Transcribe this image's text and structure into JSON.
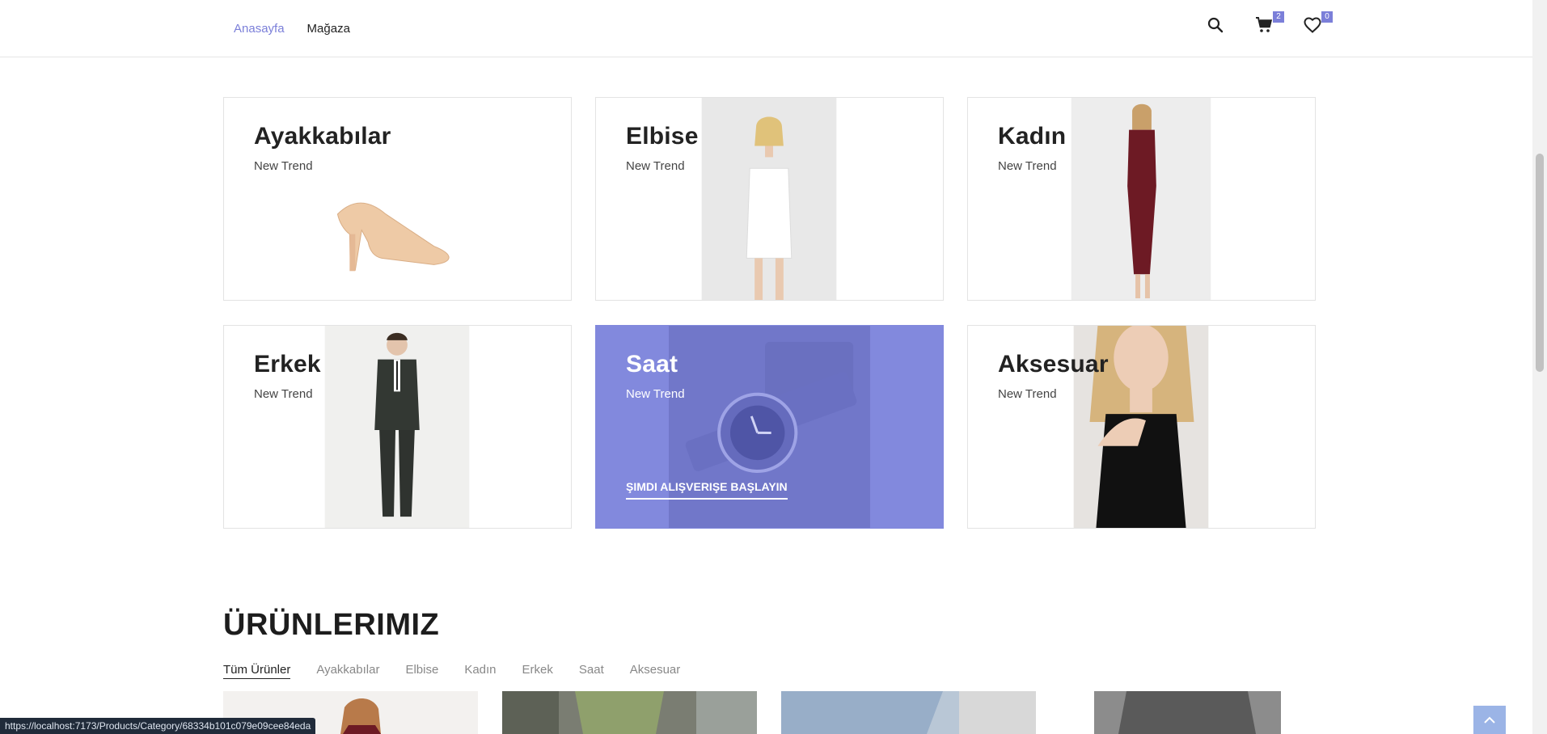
{
  "nav": {
    "items": [
      {
        "label": "Anasayfa",
        "active": true
      },
      {
        "label": "Mağaza",
        "active": false
      }
    ]
  },
  "header_icons": {
    "search": "search-icon",
    "cart": {
      "icon": "cart-icon",
      "count": "2"
    },
    "wishlist": {
      "icon": "heart-icon",
      "count": "0"
    }
  },
  "categories": [
    {
      "title": "Ayakkabılar",
      "subtitle": "New Trend"
    },
    {
      "title": "Elbise",
      "subtitle": "New Trend"
    },
    {
      "title": "Kadın",
      "subtitle": "New Trend"
    },
    {
      "title": "Erkek",
      "subtitle": "New Trend"
    },
    {
      "title": "Saat",
      "subtitle": "New Trend",
      "cta": "ŞIMDI ALIŞVERIŞE BAŞLAYIN"
    },
    {
      "title": "Aksesuar",
      "subtitle": "New Trend"
    }
  ],
  "products": {
    "title": "ÜRÜNLERIMIZ",
    "filters": [
      "Tüm Ürünler",
      "Ayakkabılar",
      "Elbise",
      "Kadın",
      "Erkek",
      "Saat",
      "Aksesuar"
    ],
    "active_filter": "Tüm Ürünler"
  },
  "status_url": "https://localhost:7173/Products/Category/68334b101c079e09cee84eda",
  "colors": {
    "accent": "#7b7fd9",
    "highlight_card": "#8289dd"
  }
}
